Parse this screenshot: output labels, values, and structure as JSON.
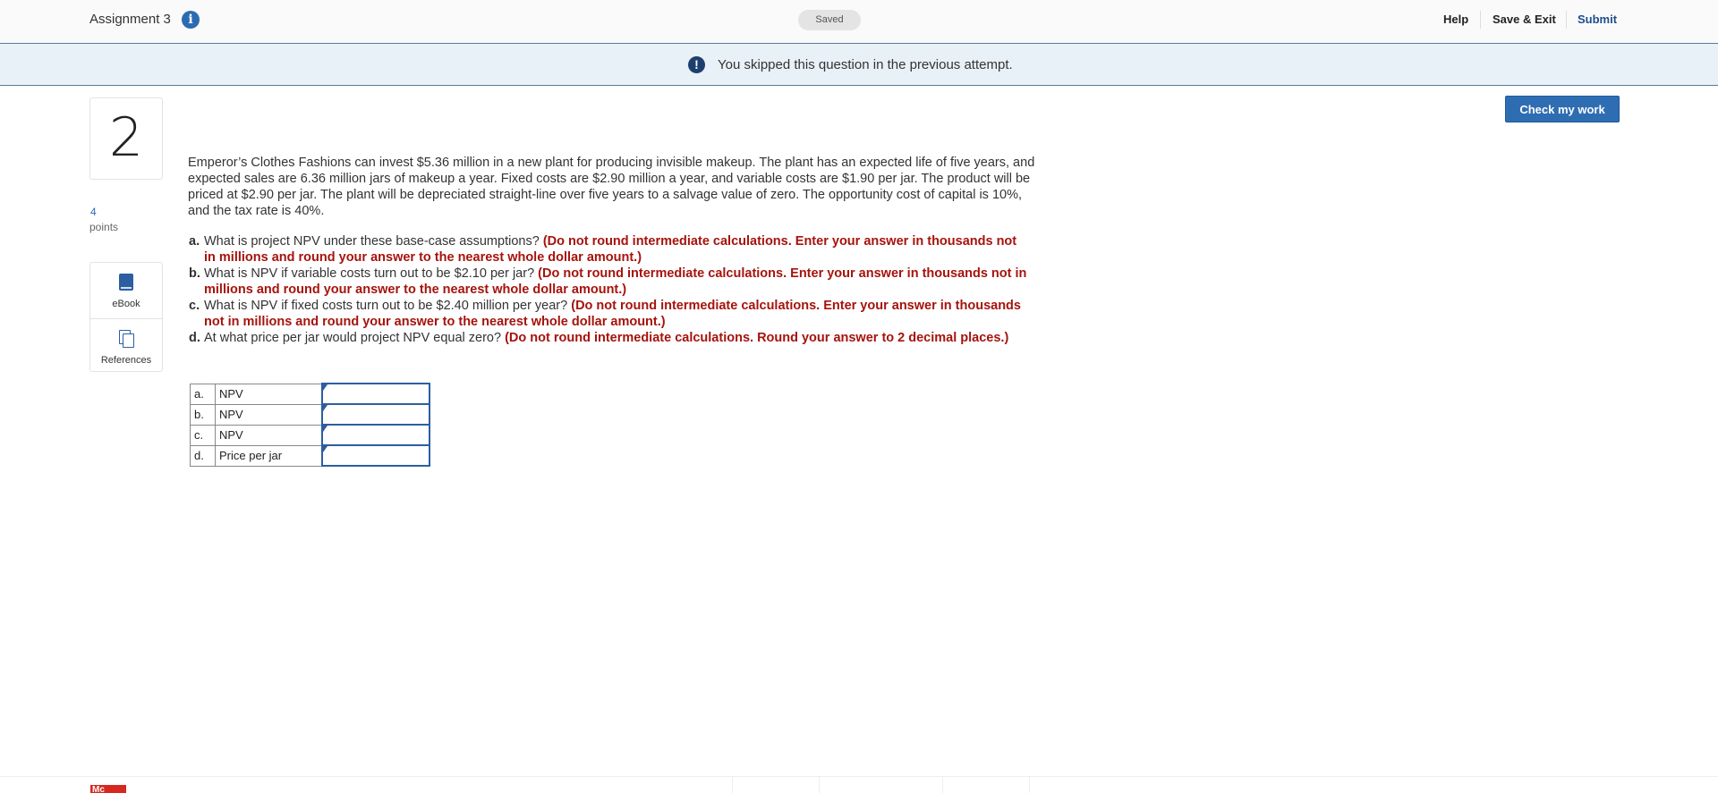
{
  "header": {
    "assignment_title": "Assignment 3",
    "status": "Saved",
    "links": {
      "help": "Help",
      "save_exit": "Save & Exit",
      "submit": "Submit"
    }
  },
  "banner": {
    "message": "You skipped this question in the previous attempt."
  },
  "actions": {
    "check_work": "Check my work"
  },
  "question": {
    "number": "2",
    "points_value": "4",
    "points_label": "points",
    "tools": {
      "ebook": "eBook",
      "references": "References"
    },
    "text": "Emperor’s Clothes Fashions can invest $5.36 million in a new plant for producing invisible makeup. The plant has an expected life of five years, and expected sales are 6.36 million jars of makeup a year. Fixed costs are $2.90 million a year, and variable costs are $1.90 per jar. The product will be priced at $2.90 per jar. The plant will be depreciated straight-line over five years to a salvage value of zero. The opportunity cost of capital is 10%, and the tax rate is 40%.",
    "parts": [
      {
        "letter": "a.",
        "text": "What is project NPV under these base-case assumptions?",
        "instruction": "(Do not round intermediate calculations. Enter your answer in thousands not in millions and round your answer to the nearest whole dollar amount.)"
      },
      {
        "letter": "b.",
        "text": "What is NPV if variable costs turn out to be $2.10 per jar?",
        "instruction": "(Do not round intermediate calculations. Enter your answer in thousands not in millions and round your answer to the nearest whole dollar amount.)"
      },
      {
        "letter": "c.",
        "text": "What is NPV if fixed costs turn out to be $2.40 million per year?",
        "instruction": "(Do not round intermediate calculations. Enter your answer in thousands not in millions and round your answer to the nearest whole dollar amount.)"
      },
      {
        "letter": "d.",
        "text": "At what price per jar would project NPV equal zero?",
        "instruction": "(Do not round intermediate calculations. Round your answer to 2 decimal places.)"
      }
    ]
  },
  "answers": [
    {
      "letter": "a.",
      "label": "NPV",
      "value": ""
    },
    {
      "letter": "b.",
      "label": "NPV",
      "value": ""
    },
    {
      "letter": "c.",
      "label": "NPV",
      "value": ""
    },
    {
      "letter": "d.",
      "label": "Price per jar",
      "value": ""
    }
  ],
  "footer": {
    "logo_text": "Mc"
  },
  "colors": {
    "accent": "#2f6db3",
    "instruction_red": "#a6130d",
    "banner_bg": "#e8f0f8",
    "header_bg": "#fafafa"
  },
  "icons": {
    "info": "info-icon",
    "alert": "alert-icon",
    "ebook": "book-icon",
    "references": "references-icon"
  }
}
